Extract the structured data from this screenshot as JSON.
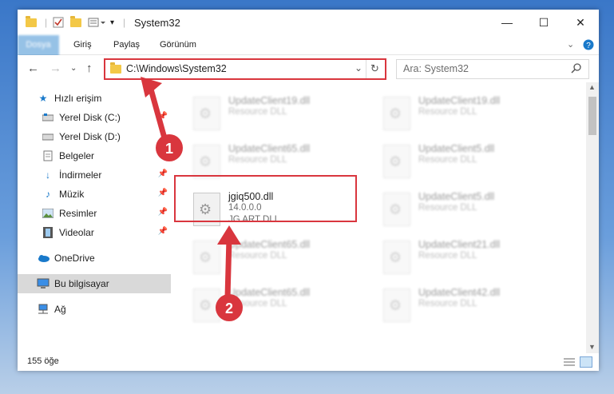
{
  "window": {
    "title": "System32"
  },
  "ribbon": {
    "tabs": [
      "Dosya",
      "Giriş",
      "Paylaş",
      "Görünüm"
    ]
  },
  "nav": {
    "address": "C:\\Windows\\System32",
    "search_placeholder": "Ara: System32"
  },
  "sidebar": {
    "items": [
      {
        "label": "Hızlı erişim",
        "icon": "star-icon"
      },
      {
        "label": "Yerel Disk (C:)",
        "icon": "drive-icon"
      },
      {
        "label": "Yerel Disk (D:)",
        "icon": "drive-icon"
      },
      {
        "label": "Belgeler",
        "icon": "documents-icon"
      },
      {
        "label": "İndirmeler",
        "icon": "download-icon"
      },
      {
        "label": "Müzik",
        "icon": "music-icon"
      },
      {
        "label": "Resimler",
        "icon": "pictures-icon"
      },
      {
        "label": "Videolar",
        "icon": "videos-icon"
      },
      {
        "label": "OneDrive",
        "icon": "cloud-icon"
      },
      {
        "label": "Bu bilgisayar",
        "icon": "computer-icon"
      },
      {
        "label": "Ağ",
        "icon": "network-icon"
      }
    ]
  },
  "files": [
    {
      "name": "UpdateClient19.dll",
      "line2": "Resource DLL",
      "line3": ""
    },
    {
      "name": "UpdateClient19.dll",
      "line2": "Resource DLL",
      "line3": ""
    },
    {
      "name": "UpdateClient65.dll",
      "line2": "Resource DLL",
      "line3": ""
    },
    {
      "name": "UpdateClient5.dll",
      "line2": "Resource DLL",
      "line3": ""
    },
    {
      "name": "jgiq500.dll",
      "line2": "14.0.0.0",
      "line3": "JG ART DLL"
    },
    {
      "name": "UpdateClient5.dll",
      "line2": "Resource DLL",
      "line3": ""
    },
    {
      "name": "UpdateClient65.dll",
      "line2": "Resource DLL",
      "line3": ""
    },
    {
      "name": "UpdateClient21.dll",
      "line2": "Resource DLL",
      "line3": ""
    },
    {
      "name": "UpdateClient65.dll",
      "line2": "Resource DLL",
      "line3": ""
    },
    {
      "name": "UpdateClient42.dll",
      "line2": "Resource DLL",
      "line3": ""
    }
  ],
  "status": {
    "count": "155 öğe"
  },
  "annotations": {
    "step1": "1",
    "step2": "2",
    "color": "#d9363e"
  }
}
